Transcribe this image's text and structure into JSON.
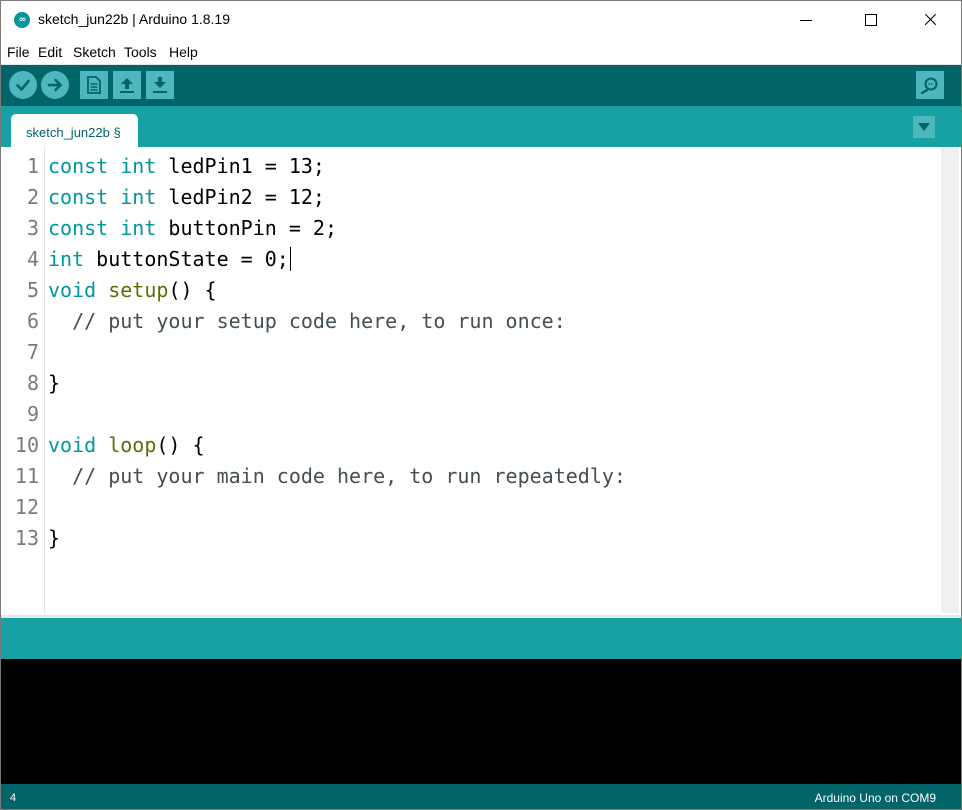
{
  "window": {
    "title": "sketch_jun22b | Arduino 1.8.19",
    "app_icon_glyph": "∞"
  },
  "menu": [
    "File",
    "Edit",
    "Sketch",
    "Tools",
    "Help"
  ],
  "toolbar": {
    "buttons": [
      "verify-icon",
      "upload-icon",
      "new-icon",
      "open-icon",
      "save-icon"
    ],
    "serial_monitor": "serial-monitor-icon"
  },
  "tabs": [
    {
      "label": "sketch_jun22b §"
    }
  ],
  "editor": {
    "line_numbers": [
      "1",
      "2",
      "3",
      "4",
      "5",
      "6",
      "7",
      "8",
      "9",
      "10",
      "11",
      "12",
      "13"
    ],
    "lines": [
      [
        {
          "t": "const",
          "c": "kw"
        },
        {
          "t": " "
        },
        {
          "t": "int",
          "c": "kw"
        },
        {
          "t": " ledPin1 = 13;"
        }
      ],
      [
        {
          "t": "const",
          "c": "kw"
        },
        {
          "t": " "
        },
        {
          "t": "int",
          "c": "kw"
        },
        {
          "t": " ledPin2 = 12;"
        }
      ],
      [
        {
          "t": "const",
          "c": "kw"
        },
        {
          "t": " "
        },
        {
          "t": "int",
          "c": "kw"
        },
        {
          "t": " buttonPin = 2;"
        }
      ],
      [
        {
          "t": "int",
          "c": "kw"
        },
        {
          "t": " buttonState = 0;"
        }
      ],
      [
        {
          "t": "void",
          "c": "kw"
        },
        {
          "t": " "
        },
        {
          "t": "setup",
          "c": "fn"
        },
        {
          "t": "() {"
        }
      ],
      [
        {
          "t": "  // put your setup code here, to run once:",
          "c": "cm"
        }
      ],
      [],
      [
        {
          "t": "}"
        }
      ],
      [],
      [
        {
          "t": "void",
          "c": "kw"
        },
        {
          "t": " "
        },
        {
          "t": "loop",
          "c": "fn"
        },
        {
          "t": "() {"
        }
      ],
      [
        {
          "t": "  // put your main code here, to run repeatedly:",
          "c": "cm"
        }
      ],
      [],
      [
        {
          "t": "}"
        }
      ]
    ]
  },
  "colors": {
    "toolbar": "#006468",
    "tabbar": "#17a1a5",
    "keyword": "#00979c",
    "function": "#5e6d03",
    "console": "#000000"
  },
  "footer": {
    "line": "4",
    "board": "Arduino Uno on COM9"
  }
}
